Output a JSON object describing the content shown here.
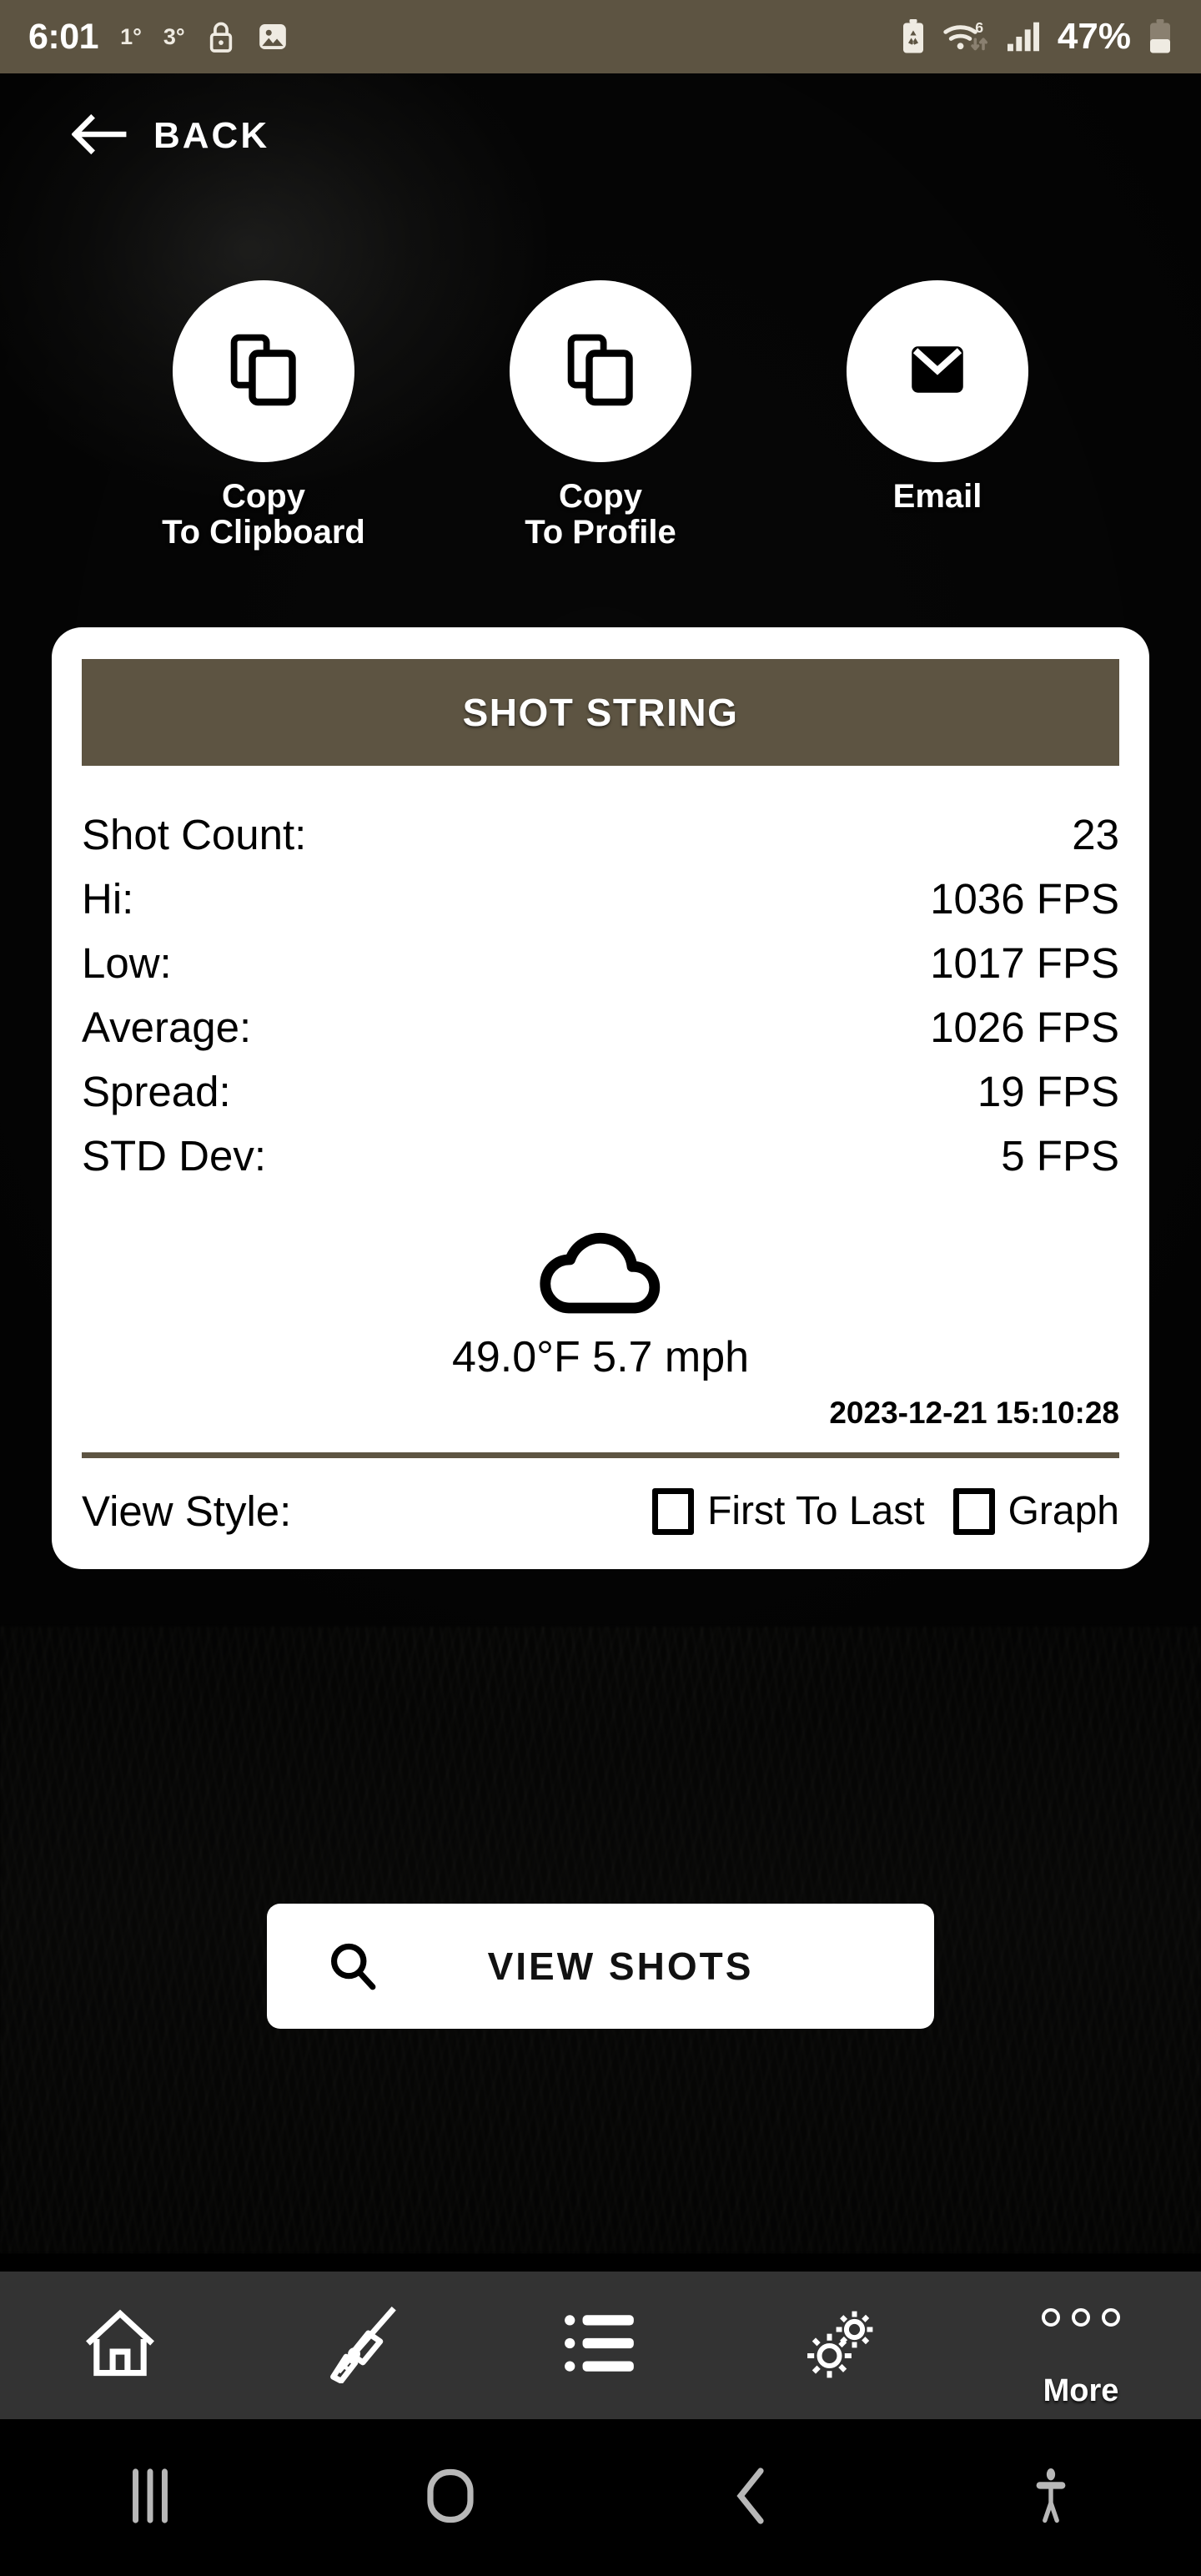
{
  "statusbar": {
    "time": "6:01",
    "temp_indoor": "1°",
    "temp_outdoor": "3°",
    "lock_icon": "lock-icon",
    "gallery_icon": "image-icon",
    "battery_saver_icon": "battery-saver-icon",
    "wifi_icon": "wifi-6-icon",
    "signal_icon": "cellular-signal-icon",
    "battery_percent": "47%",
    "battery_icon": "battery-icon",
    "bg_color": "#5d5442"
  },
  "header": {
    "back_label": "BACK",
    "back_icon": "arrow-left-icon"
  },
  "actions": [
    {
      "label": "Copy\nTo Clipboard",
      "icon": "copy-icon"
    },
    {
      "label": "Copy\nTo Profile",
      "icon": "copy-icon"
    },
    {
      "label": "Email",
      "icon": "email-icon"
    }
  ],
  "card": {
    "title": "SHOT STRING",
    "title_bg": "#5d5442",
    "stats": [
      {
        "label": "Shot Count:",
        "value": "23"
      },
      {
        "label": "Hi:",
        "value": "1036 FPS"
      },
      {
        "label": "Low:",
        "value": "1017 FPS"
      },
      {
        "label": "Average:",
        "value": "1026 FPS"
      },
      {
        "label": "Spread:",
        "value": "19 FPS"
      },
      {
        "label": "STD Dev:",
        "value": "5 FPS"
      }
    ],
    "weather": {
      "icon": "cloud-icon",
      "text": "49.0°F 5.7 mph"
    },
    "timestamp": "2023-12-21 15:10:28",
    "view_style": {
      "label": "View Style:",
      "options": [
        {
          "label": "First To Last",
          "checked": false
        },
        {
          "label": "Graph",
          "checked": false
        }
      ]
    }
  },
  "view_shots": {
    "label": "VIEW SHOTS",
    "icon": "search-icon"
  },
  "app_nav": [
    {
      "name": "home",
      "icon": "home-icon",
      "label": ""
    },
    {
      "name": "rifle",
      "icon": "rifle-scope-icon",
      "label": ""
    },
    {
      "name": "list",
      "icon": "list-icon",
      "label": ""
    },
    {
      "name": "settings",
      "icon": "gears-icon",
      "label": ""
    },
    {
      "name": "more",
      "icon": "three-dots-icon",
      "label": "More"
    }
  ],
  "system_nav": {
    "recents_icon": "recents-icon",
    "home_icon": "home-circle-icon",
    "back_icon": "back-chevron-icon",
    "accessibility_icon": "accessibility-icon"
  }
}
